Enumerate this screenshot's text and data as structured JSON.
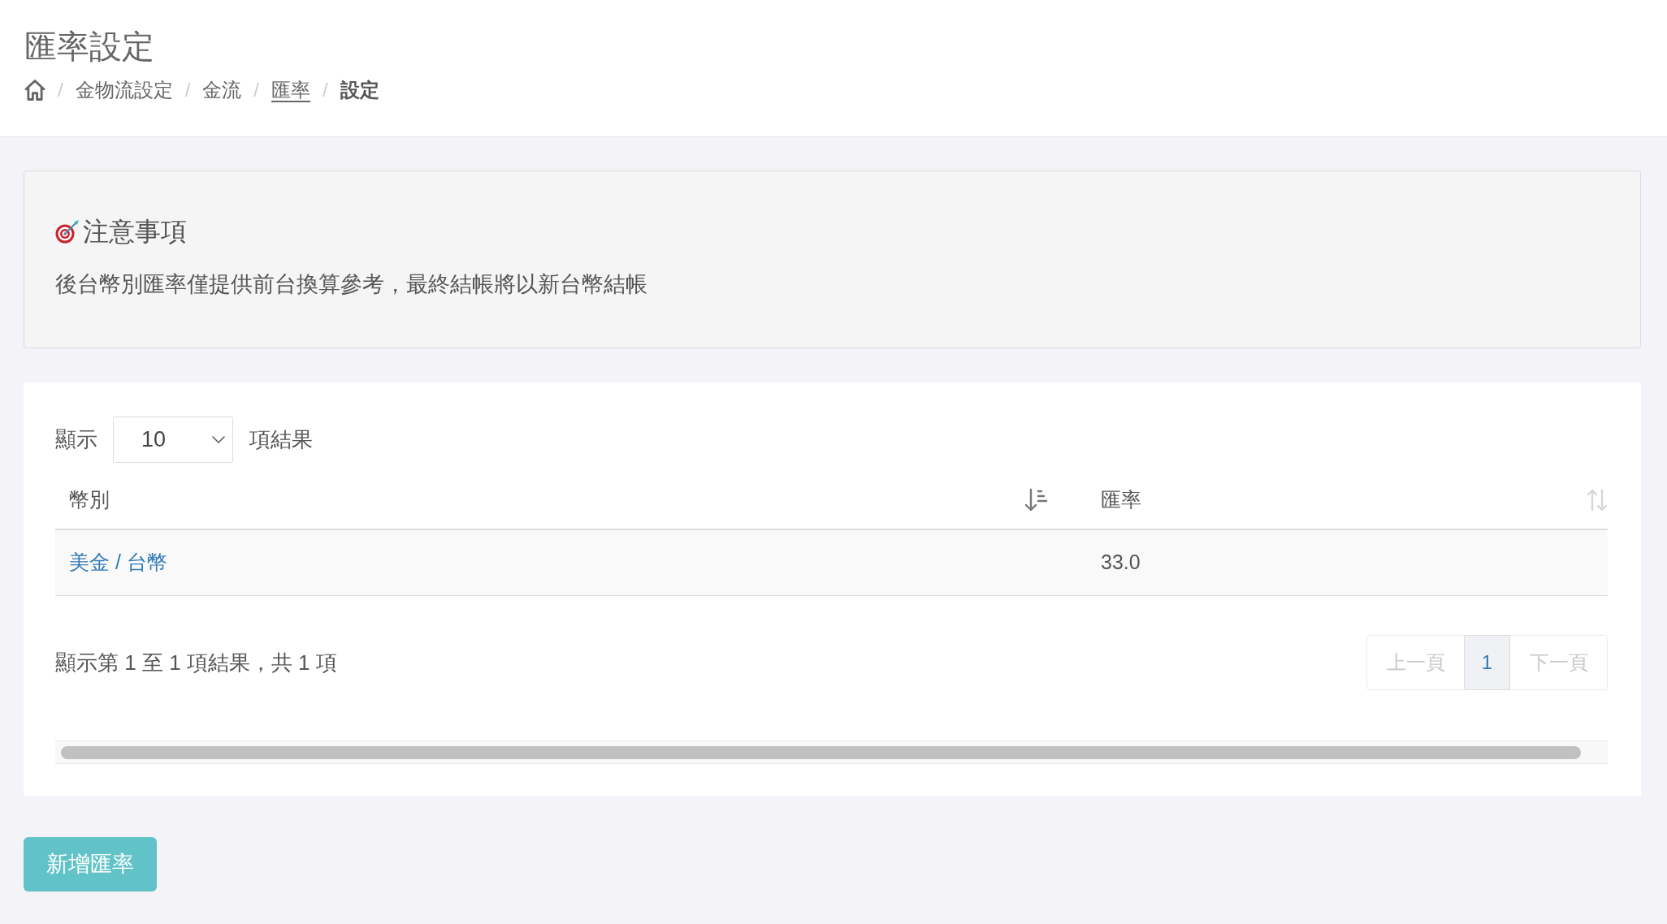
{
  "page_header": {
    "title": "匯率設定",
    "breadcrumb": {
      "separator": "/",
      "items": [
        {
          "kind": "home"
        },
        {
          "kind": "text",
          "label": "金物流設定"
        },
        {
          "kind": "text",
          "label": "金流"
        },
        {
          "kind": "link",
          "label": "匯率"
        },
        {
          "kind": "current",
          "label": "設定"
        }
      ]
    }
  },
  "notice": {
    "title": "注意事項",
    "text": "後台幣別匯率僅提供前台換算參考，最終結帳將以新台幣結帳"
  },
  "table_panel": {
    "length_menu": {
      "label_before": "顯示",
      "value": "10",
      "label_after": "項結果"
    },
    "columns": [
      {
        "label": "幣別",
        "sorted": true
      },
      {
        "label": "匯率",
        "sorted": false
      }
    ],
    "rows": [
      {
        "cells": [
          {
            "kind": "link",
            "text": "美金 / 台幣"
          },
          {
            "kind": "text",
            "text": "33.0"
          }
        ]
      }
    ],
    "info": "顯示第 1 至 1 項結果，共 1 項",
    "pagination": [
      {
        "label": "上一頁",
        "selected": false,
        "disabled": true
      },
      {
        "label": "1",
        "selected": true,
        "disabled": false
      },
      {
        "label": "下一頁",
        "selected": false,
        "disabled": true
      }
    ]
  },
  "add_button": {
    "label": "新增匯率"
  }
}
